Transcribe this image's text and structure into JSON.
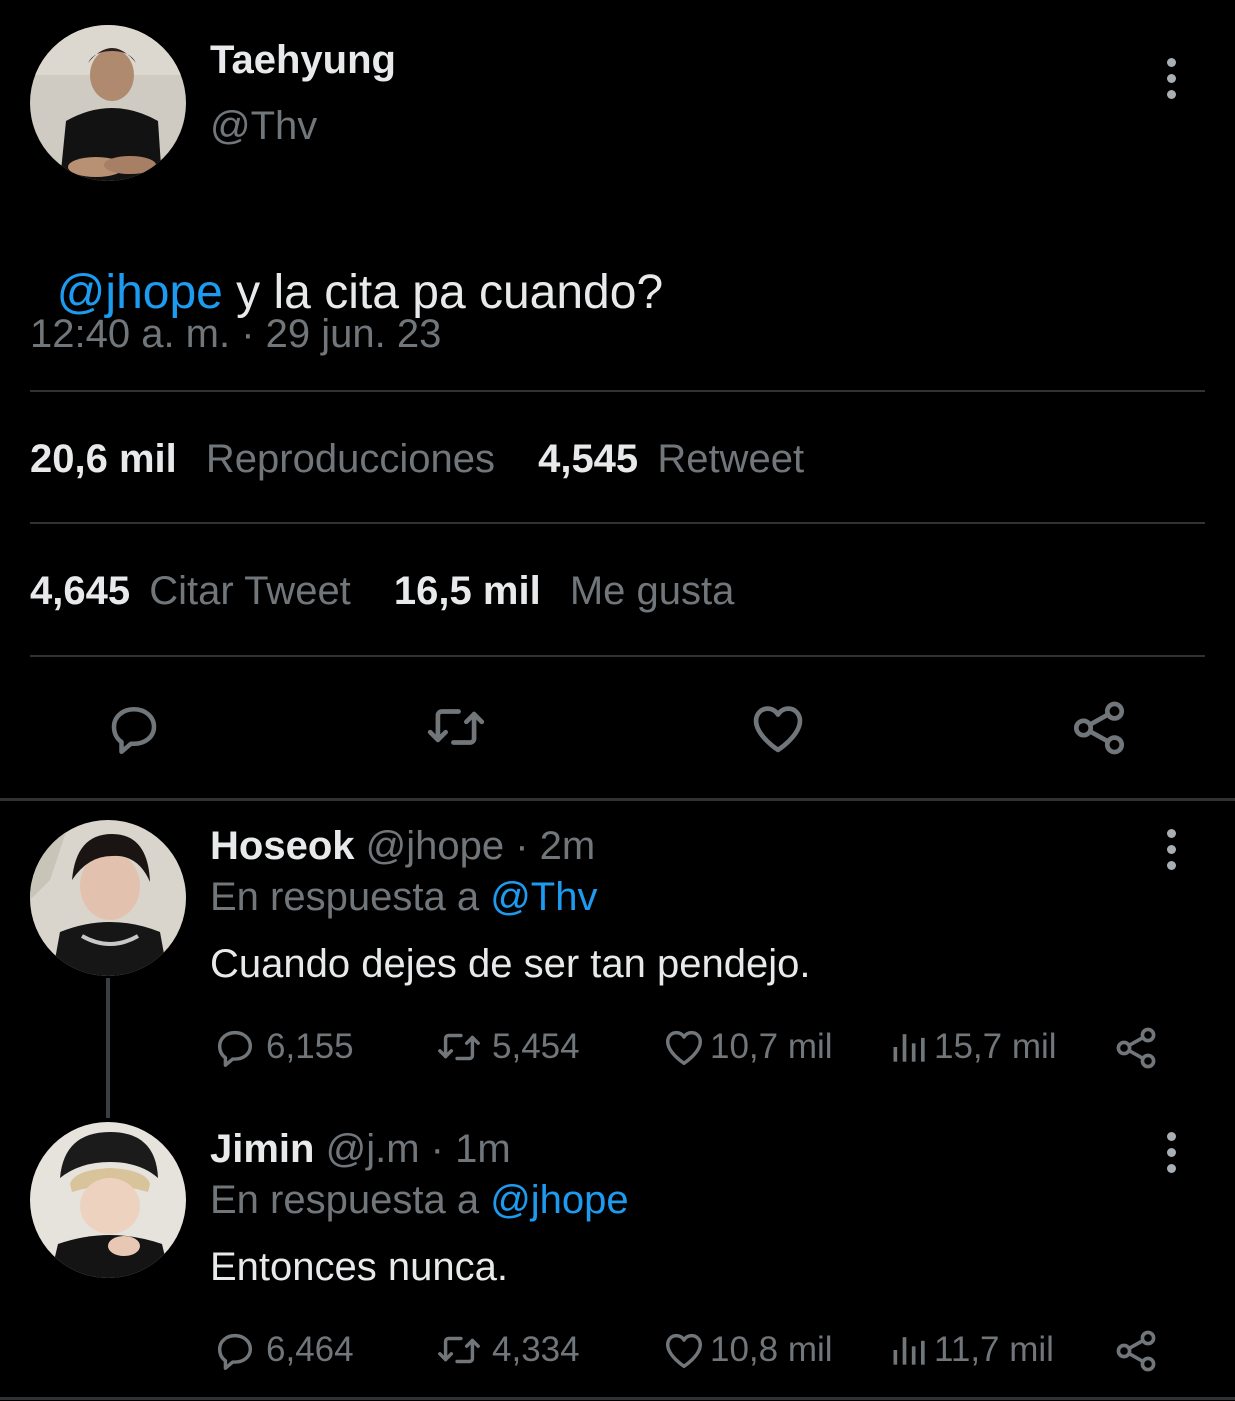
{
  "tweet": {
    "author_name": "Taehyung",
    "author_handle": "@Thv",
    "mention": "@jhope",
    "text": " y la cita pa cuando?",
    "timestamp": "12:40 a. m. · 29 jun. 23",
    "stats": {
      "views_count": "20,6 mil",
      "views_label": "Reproducciones",
      "retweets_count": "4,545",
      "retweets_label": "Retweet",
      "quotes_count": "4,645",
      "quotes_label": "Citar Tweet",
      "likes_count": "16,5 mil",
      "likes_label": "Me gusta"
    },
    "icons": [
      "reply-icon",
      "retweet-icon",
      "like-icon",
      "share-icon"
    ]
  },
  "replies": [
    {
      "name": "Hoseok",
      "handle_time": "@jhope · 2m",
      "reply_prefix": "En respuesta a",
      "reply_to": "@Thv",
      "text": "Cuando dejes de ser tan pendejo.",
      "replies": "6,155",
      "retweets": "5,454",
      "likes": "10,7 mil",
      "views": "15,7 mil"
    },
    {
      "name": "Jimin",
      "handle_time": "@j.m · 1m",
      "reply_prefix": "En respuesta a",
      "reply_to": "@jhope",
      "text": "Entonces nunca.",
      "replies": "6,464",
      "retweets": "4,334",
      "likes": "10,8 mil",
      "views": "11,7 mil"
    }
  ],
  "colors": {
    "background": "#000000",
    "text": "#e7e9ea",
    "muted": "#71767b",
    "link": "#1d9bf0",
    "divider": "#2f3336"
  }
}
